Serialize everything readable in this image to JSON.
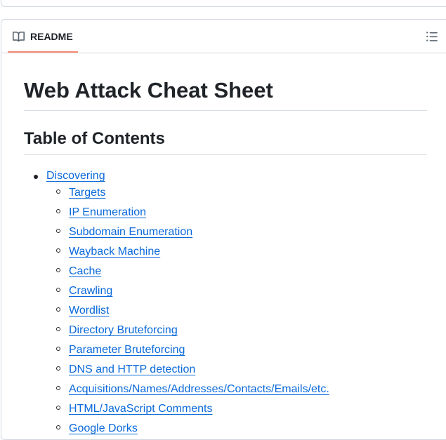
{
  "readme": {
    "tab_label": "README",
    "title": "Web Attack Cheat Sheet",
    "toc_heading": "Table of Contents"
  },
  "toc": {
    "section": "Discovering",
    "items": [
      "Targets",
      "IP Enumeration",
      "Subdomain Enumeration",
      "Wayback Machine",
      "Cache",
      "Crawling",
      "Wordlist",
      "Directory Bruteforcing",
      "Parameter Bruteforcing",
      "DNS and HTTP detection",
      "Acquisitions/Names/Addresses/Contacts/Emails/etc.",
      "HTML/JavaScript Comments",
      "Google Dorks"
    ]
  },
  "icons": {
    "tab_icon": "book-icon",
    "outline_icon": "list-unordered-icon"
  },
  "colors": {
    "link": "#0969da",
    "tab_underline": "#fd8c73",
    "border": "#d0d7de"
  }
}
